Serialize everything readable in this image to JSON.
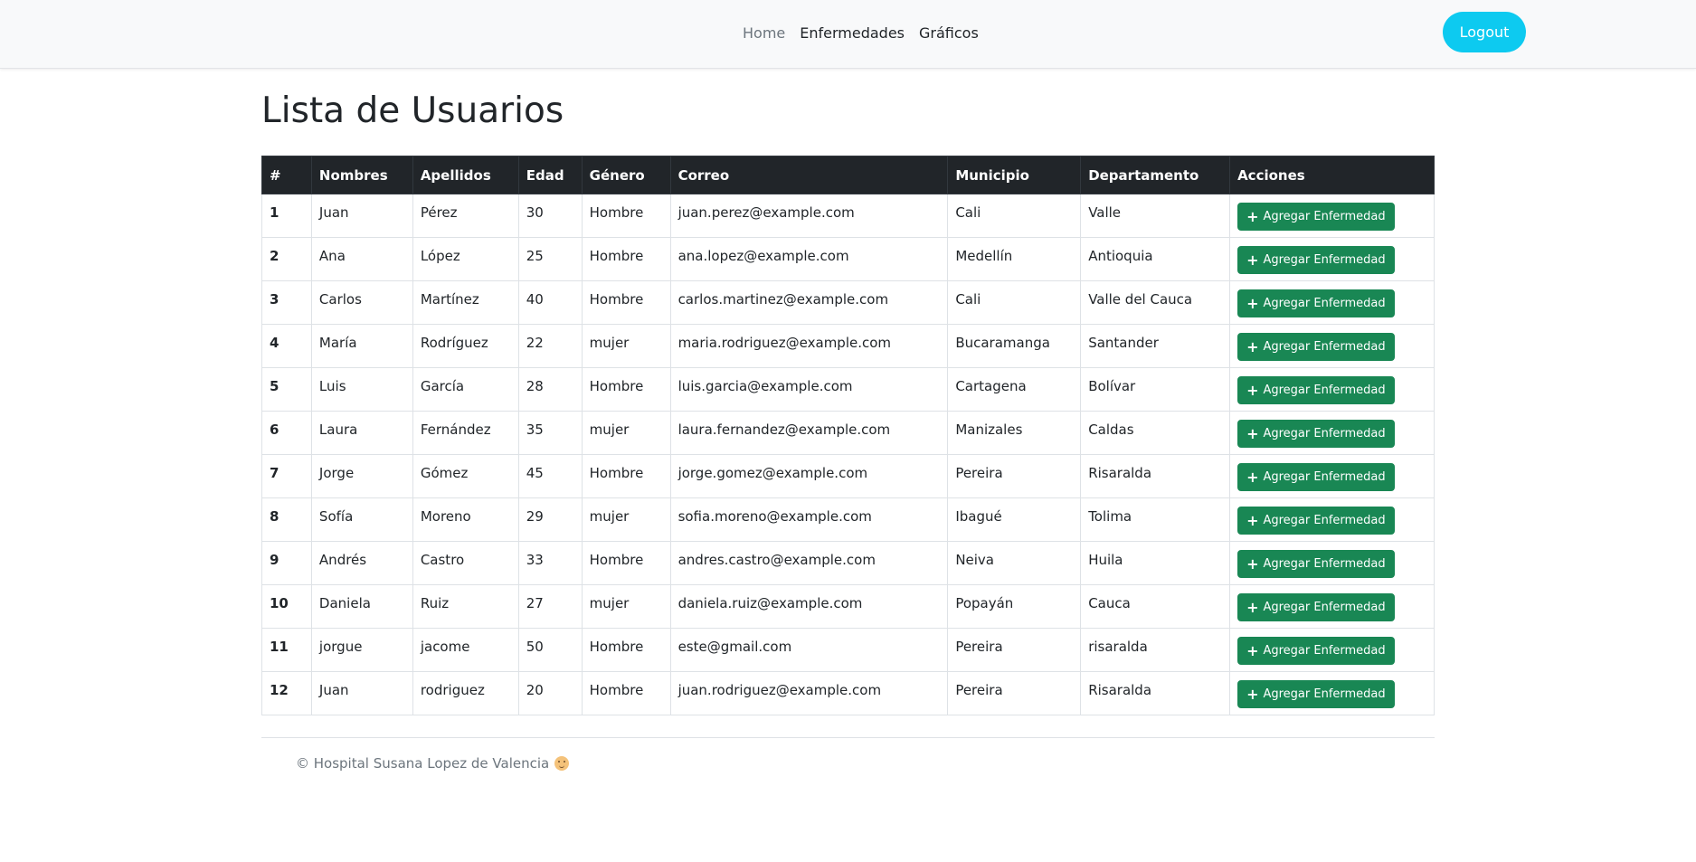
{
  "nav": {
    "links": [
      "Home",
      "Enfermedades",
      "Gráficos"
    ],
    "logout_label": "Logout"
  },
  "page": {
    "title": "Lista de Usuarios"
  },
  "table": {
    "columns": [
      "#",
      "Nombres",
      "Apellidos",
      "Edad",
      "Género",
      "Correo",
      "Municipio",
      "Departamento",
      "Acciones"
    ],
    "action_label": "Agregar Enfermedad",
    "rows": [
      [
        "1",
        "Juan",
        "Pérez",
        "30",
        "Hombre",
        "juan.perez@example.com",
        "Cali",
        "Valle"
      ],
      [
        "2",
        "Ana",
        "López",
        "25",
        "Hombre",
        "ana.lopez@example.com",
        "Medellín",
        "Antioquia"
      ],
      [
        "3",
        "Carlos",
        "Martínez",
        "40",
        "Hombre",
        "carlos.martinez@example.com",
        "Cali",
        "Valle del Cauca"
      ],
      [
        "4",
        "María",
        "Rodríguez",
        "22",
        "mujer",
        "maria.rodriguez@example.com",
        "Bucaramanga",
        "Santander"
      ],
      [
        "5",
        "Luis",
        "García",
        "28",
        "Hombre",
        "luis.garcia@example.com",
        "Cartagena",
        "Bolívar"
      ],
      [
        "6",
        "Laura",
        "Fernández",
        "35",
        "mujer",
        "laura.fernandez@example.com",
        "Manizales",
        "Caldas"
      ],
      [
        "7",
        "Jorge",
        "Gómez",
        "45",
        "Hombre",
        "jorge.gomez@example.com",
        "Pereira",
        "Risaralda"
      ],
      [
        "8",
        "Sofía",
        "Moreno",
        "29",
        "mujer",
        "sofia.moreno@example.com",
        "Ibagué",
        "Tolima"
      ],
      [
        "9",
        "Andrés",
        "Castro",
        "33",
        "Hombre",
        "andres.castro@example.com",
        "Neiva",
        "Huila"
      ],
      [
        "10",
        "Daniela",
        "Ruiz",
        "27",
        "mujer",
        "daniela.ruiz@example.com",
        "Popayán",
        "Cauca"
      ],
      [
        "11",
        "jorgue",
        "jacome",
        "50",
        "Hombre",
        "este@gmail.com",
        "Pereira",
        "risaralda"
      ],
      [
        "12",
        "Juan",
        "rodriguez",
        "20",
        "Hombre",
        "juan.rodriguez@example.com",
        "Pereira",
        "Risaralda"
      ]
    ]
  },
  "footer": {
    "text": "© Hospital Susana Lopez de Valencia"
  },
  "colors": {
    "navbar_bg": "#f8f9fa",
    "logout_bg": "#0dcaf0",
    "table_header_bg": "#212529",
    "action_button_bg": "#198754"
  },
  "icons": {
    "action_button": "plus-icon",
    "footer": "baby-face-icon"
  }
}
